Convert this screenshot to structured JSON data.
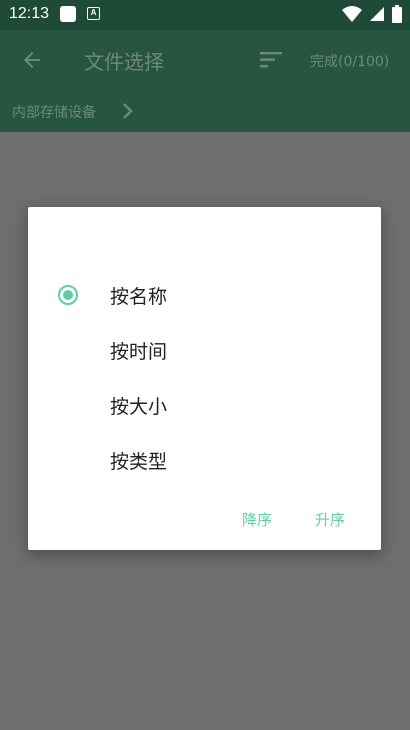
{
  "status_bar": {
    "time": "12:13"
  },
  "app_bar": {
    "title": "文件选择",
    "done_label": "完成(0/100)"
  },
  "breadcrumb": {
    "path": "内部存储设备"
  },
  "dialog": {
    "options": [
      {
        "label": "按名称",
        "selected": true
      },
      {
        "label": "按时间",
        "selected": false
      },
      {
        "label": "按大小",
        "selected": false
      },
      {
        "label": "按类型",
        "selected": false
      }
    ],
    "descending_label": "降序",
    "ascending_label": "升序"
  },
  "colors": {
    "accent": "#5fcfa5",
    "app_bar": "#285542",
    "status_bar": "#1f4a37",
    "scrim": "#6e6e6e"
  }
}
